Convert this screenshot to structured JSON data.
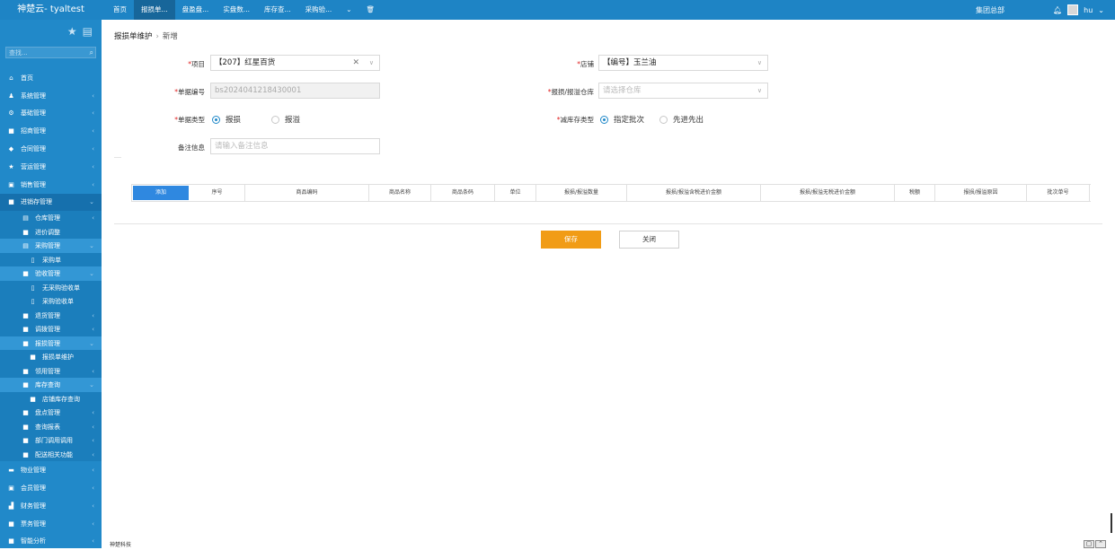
{
  "app": {
    "title": "神楚云- tyaltest",
    "org": "集团总部",
    "user": "hu"
  },
  "top_tabs": [
    {
      "label": "首页",
      "active": false
    },
    {
      "label": "报损单...",
      "active": true
    },
    {
      "label": "盘盈盘...",
      "active": false
    },
    {
      "label": "实盘数...",
      "active": false
    },
    {
      "label": "库存查...",
      "active": false
    },
    {
      "label": "采购验...",
      "active": false
    }
  ],
  "sidebar": {
    "search_placeholder": "查找...",
    "menu": [
      {
        "label": "首页",
        "level": 0,
        "icon": "home-icon",
        "glyph": "⌂"
      },
      {
        "label": "系统管理",
        "level": 0,
        "icon": "user-icon",
        "glyph": "♟",
        "arrow": "‹"
      },
      {
        "label": "基础管理",
        "level": 0,
        "icon": "gear-icon",
        "glyph": "⚙",
        "arrow": "‹"
      },
      {
        "label": "招商管理",
        "level": 0,
        "icon": "grid-icon",
        "glyph": "■",
        "arrow": "‹"
      },
      {
        "label": "合同管理",
        "level": 0,
        "icon": "tag-icon",
        "glyph": "◆",
        "arrow": "‹"
      },
      {
        "label": "营运管理",
        "level": 0,
        "icon": "star-icon",
        "glyph": "★",
        "arrow": "‹"
      },
      {
        "label": "销售管理",
        "level": 0,
        "icon": "monitor-icon",
        "glyph": "▣",
        "arrow": "‹"
      },
      {
        "label": "进销存管理",
        "level": 0,
        "icon": "grid-icon",
        "glyph": "■",
        "arrow": "⌄",
        "state": "open"
      },
      {
        "label": "仓库管理",
        "level": 1,
        "icon": "file-icon",
        "glyph": "▤",
        "arrow": "‹"
      },
      {
        "label": "进价调整",
        "level": 1,
        "icon": "grid-icon",
        "glyph": "■"
      },
      {
        "label": "采购管理",
        "level": 1,
        "icon": "file-icon",
        "glyph": "▤",
        "arrow": "⌄",
        "state": "hl"
      },
      {
        "label": "采购单",
        "level": 2,
        "icon": "doc-icon",
        "glyph": "▯"
      },
      {
        "label": "验收管理",
        "level": 1,
        "icon": "grid-icon",
        "glyph": "■",
        "arrow": "⌄",
        "state": "hl"
      },
      {
        "label": "无采购验收单",
        "level": 2,
        "icon": "doc-icon",
        "glyph": "▯"
      },
      {
        "label": "采购验收单",
        "level": 2,
        "icon": "doc-icon",
        "glyph": "▯"
      },
      {
        "label": "退货管理",
        "level": 1,
        "icon": "grid-icon",
        "glyph": "■",
        "arrow": "‹"
      },
      {
        "label": "调拨管理",
        "level": 1,
        "icon": "grid-icon",
        "glyph": "■",
        "arrow": "‹"
      },
      {
        "label": "报损管理",
        "level": 1,
        "icon": "grid-icon",
        "glyph": "■",
        "arrow": "⌄",
        "state": "hl"
      },
      {
        "label": "报损单维护",
        "level": 2,
        "icon": "grid-icon",
        "glyph": "■"
      },
      {
        "label": "领用管理",
        "level": 1,
        "icon": "grid-icon",
        "glyph": "■",
        "arrow": "‹"
      },
      {
        "label": "库存查询",
        "level": 1,
        "icon": "grid-icon",
        "glyph": "■",
        "arrow": "⌄",
        "state": "hl"
      },
      {
        "label": "店铺库存查询",
        "level": 2,
        "icon": "grid-icon",
        "glyph": "■"
      },
      {
        "label": "盘点管理",
        "level": 1,
        "icon": "grid-icon",
        "glyph": "■",
        "arrow": "‹"
      },
      {
        "label": "查询报表",
        "level": 1,
        "icon": "grid-icon",
        "glyph": "■",
        "arrow": "‹"
      },
      {
        "label": "部门调用调用",
        "level": 1,
        "icon": "grid-icon",
        "glyph": "■",
        "arrow": "‹"
      },
      {
        "label": "配送相关功能",
        "level": 1,
        "icon": "grid-icon",
        "glyph": "■",
        "arrow": "‹"
      },
      {
        "label": "物业管理",
        "level": 0,
        "icon": "building-icon",
        "glyph": "▬",
        "arrow": "‹"
      },
      {
        "label": "会员管理",
        "level": 0,
        "icon": "member-icon",
        "glyph": "▣",
        "arrow": "‹"
      },
      {
        "label": "财务管理",
        "level": 0,
        "icon": "chart-icon",
        "glyph": "▟",
        "arrow": "‹"
      },
      {
        "label": "票务管理",
        "level": 0,
        "icon": "grid-icon",
        "glyph": "■",
        "arrow": "‹"
      },
      {
        "label": "智能分析",
        "level": 0,
        "icon": "grid-icon",
        "glyph": "■",
        "arrow": "‹"
      }
    ]
  },
  "breadcrumb": {
    "parent": "报损单维护",
    "current": "新增"
  },
  "form": {
    "project": {
      "label": "项目",
      "value": "【207】红星百货"
    },
    "shop": {
      "label": "店铺",
      "value": "【编号】玉兰油"
    },
    "doc_no": {
      "label": "单据编号",
      "value": "bs2024041218430001"
    },
    "warehouse": {
      "label": "报损/报溢仓库",
      "placeholder": "请选择仓库"
    },
    "doc_type": {
      "label": "单据类型",
      "options": [
        "报损",
        "报溢"
      ],
      "selected": "报损"
    },
    "deduct_type": {
      "label": "减库存类型",
      "options": [
        "指定批次",
        "先进先出"
      ],
      "selected": "指定批次"
    },
    "remark": {
      "label": "备注信息",
      "placeholder": "请输入备注信息"
    }
  },
  "grid": {
    "add_label": "添加",
    "columns": [
      "序号",
      "商品编码",
      "商品名称",
      "商品条码",
      "单位",
      "报损/报溢数量",
      "报损/报溢含税进价金额",
      "报损/报溢无税进价金额",
      "税额",
      "报损/报溢原因",
      "批次单号"
    ]
  },
  "buttons": {
    "save": "保存",
    "close": "关闭"
  },
  "footer": {
    "text": "神楚科技"
  },
  "colors": {
    "topbar": "#1e84c5",
    "sidebar": "#2189c9",
    "primary": "#f19c16",
    "add": "#2f88e0"
  }
}
